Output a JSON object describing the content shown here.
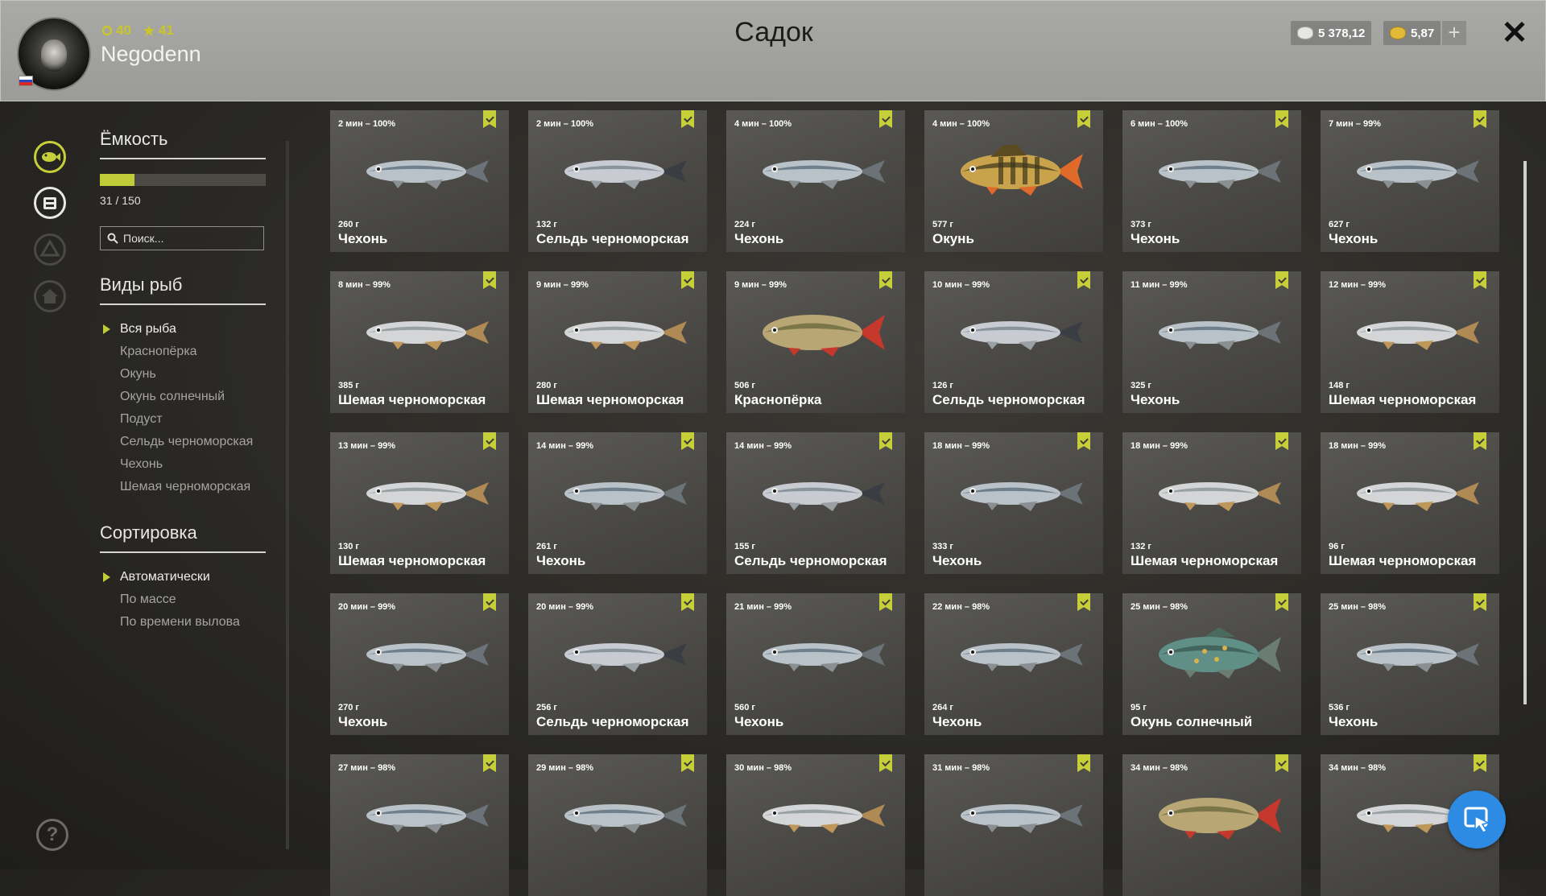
{
  "header": {
    "player_name": "Negodenn",
    "level": "40",
    "stars": "41",
    "title": "Садок",
    "silver": "5 378,12",
    "gold": "5,87",
    "plus_label": "+",
    "close_label": "✕"
  },
  "colors": {
    "accent": "#c6cf3a",
    "fab": "#2e8be4"
  },
  "capacity": {
    "title": "Ёмкость",
    "value_text": "31 / 150",
    "fraction": 0.2067
  },
  "search": {
    "placeholder": "Поиск..."
  },
  "species": {
    "title": "Виды рыб",
    "items": [
      "Вся рыба",
      "Краснопёрка",
      "Окунь",
      "Окунь солнечный",
      "Подуст",
      "Сельдь черноморская",
      "Чехонь",
      "Шемая черноморская"
    ],
    "selected": 0
  },
  "sort": {
    "title": "Сортировка",
    "items": [
      "Автоматически",
      "По массе",
      "По времени вылова"
    ],
    "selected": 0
  },
  "help_label": "?",
  "fish": [
    {
      "time": "2 мин – 100%",
      "weight": "260 г",
      "name": "Чехонь",
      "kind": "chekhon"
    },
    {
      "time": "2 мин – 100%",
      "weight": "132 г",
      "name": "Сельдь черноморская",
      "kind": "herring"
    },
    {
      "time": "4 мин – 100%",
      "weight": "224 г",
      "name": "Чехонь",
      "kind": "chekhon"
    },
    {
      "time": "4 мин – 100%",
      "weight": "577 г",
      "name": "Окунь",
      "kind": "perch"
    },
    {
      "time": "6 мин – 100%",
      "weight": "373 г",
      "name": "Чехонь",
      "kind": "chekhon"
    },
    {
      "time": "7 мин – 99%",
      "weight": "627 г",
      "name": "Чехонь",
      "kind": "chekhon"
    },
    {
      "time": "8 мин – 99%",
      "weight": "385 г",
      "name": "Шемая черноморская",
      "kind": "shemaya"
    },
    {
      "time": "9 мин – 99%",
      "weight": "280 г",
      "name": "Шемая черноморская",
      "kind": "shemaya"
    },
    {
      "time": "9 мин – 99%",
      "weight": "506 г",
      "name": "Краснопёрка",
      "kind": "rudd"
    },
    {
      "time": "10 мин – 99%",
      "weight": "126 г",
      "name": "Сельдь черноморская",
      "kind": "herring"
    },
    {
      "time": "11 мин – 99%",
      "weight": "325 г",
      "name": "Чехонь",
      "kind": "chekhon"
    },
    {
      "time": "12 мин – 99%",
      "weight": "148 г",
      "name": "Шемая черноморская",
      "kind": "shemaya"
    },
    {
      "time": "13 мин – 99%",
      "weight": "130 г",
      "name": "Шемая черноморская",
      "kind": "shemaya"
    },
    {
      "time": "14 мин – 99%",
      "weight": "261 г",
      "name": "Чехонь",
      "kind": "chekhon"
    },
    {
      "time": "14 мин – 99%",
      "weight": "155 г",
      "name": "Сельдь черноморская",
      "kind": "herring"
    },
    {
      "time": "18 мин – 99%",
      "weight": "333 г",
      "name": "Чехонь",
      "kind": "chekhon"
    },
    {
      "time": "18 мин – 99%",
      "weight": "132 г",
      "name": "Шемая черноморская",
      "kind": "shemaya"
    },
    {
      "time": "18 мин – 99%",
      "weight": "96 г",
      "name": "Шемая черноморская",
      "kind": "shemaya"
    },
    {
      "time": "20 мин – 99%",
      "weight": "270 г",
      "name": "Чехонь",
      "kind": "chekhon"
    },
    {
      "time": "20 мин – 99%",
      "weight": "256 г",
      "name": "Сельдь черноморская",
      "kind": "herring"
    },
    {
      "time": "21 мин – 99%",
      "weight": "560 г",
      "name": "Чехонь",
      "kind": "chekhon"
    },
    {
      "time": "22 мин – 98%",
      "weight": "264 г",
      "name": "Чехонь",
      "kind": "chekhon"
    },
    {
      "time": "25 мин – 98%",
      "weight": "95 г",
      "name": "Окунь солнечный",
      "kind": "sunfish"
    },
    {
      "time": "25 мин – 98%",
      "weight": "536 г",
      "name": "Чехонь",
      "kind": "chekhon"
    },
    {
      "time": "27 мин – 98%",
      "weight": "",
      "name": "",
      "kind": "chekhon"
    },
    {
      "time": "29 мин – 98%",
      "weight": "",
      "name": "",
      "kind": "chekhon"
    },
    {
      "time": "30 мин – 98%",
      "weight": "",
      "name": "",
      "kind": "shemaya"
    },
    {
      "time": "31 мин – 98%",
      "weight": "",
      "name": "",
      "kind": "chekhon"
    },
    {
      "time": "34 мин – 98%",
      "weight": "",
      "name": "",
      "kind": "rudd"
    },
    {
      "time": "34 мин – 98%",
      "weight": "",
      "name": "",
      "kind": "shemaya"
    }
  ]
}
